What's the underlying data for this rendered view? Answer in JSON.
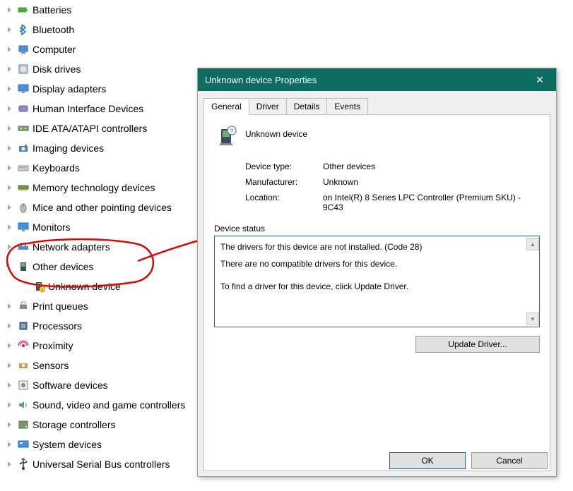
{
  "tree": {
    "items": [
      {
        "label": "Batteries",
        "icon": "battery"
      },
      {
        "label": "Bluetooth",
        "icon": "bluetooth"
      },
      {
        "label": "Computer",
        "icon": "computer"
      },
      {
        "label": "Disk drives",
        "icon": "disk"
      },
      {
        "label": "Display adapters",
        "icon": "monitor"
      },
      {
        "label": "Human Interface Devices",
        "icon": "hid"
      },
      {
        "label": "IDE ATA/ATAPI controllers",
        "icon": "ide"
      },
      {
        "label": "Imaging devices",
        "icon": "camera"
      },
      {
        "label": "Keyboards",
        "icon": "keyboard"
      },
      {
        "label": "Memory technology devices",
        "icon": "memory"
      },
      {
        "label": "Mice and other pointing devices",
        "icon": "mouse"
      },
      {
        "label": "Monitors",
        "icon": "monitor"
      },
      {
        "label": "Network adapters",
        "icon": "network"
      },
      {
        "label": "Other devices",
        "icon": "other",
        "expanded": true,
        "children": [
          {
            "label": "Unknown device",
            "icon": "unknown"
          }
        ]
      },
      {
        "label": "Print queues",
        "icon": "printer"
      },
      {
        "label": "Processors",
        "icon": "cpu"
      },
      {
        "label": "Proximity",
        "icon": "proximity"
      },
      {
        "label": "Sensors",
        "icon": "sensor"
      },
      {
        "label": "Software devices",
        "icon": "software"
      },
      {
        "label": "Sound, video and game controllers",
        "icon": "sound"
      },
      {
        "label": "Storage controllers",
        "icon": "storage"
      },
      {
        "label": "System devices",
        "icon": "system"
      },
      {
        "label": "Universal Serial Bus controllers",
        "icon": "usb"
      }
    ]
  },
  "dialog": {
    "title": "Unknown device Properties",
    "close": "✕",
    "tabs": [
      "General",
      "Driver",
      "Details",
      "Events"
    ],
    "active_tab": 0,
    "device_name": "Unknown device",
    "rows": {
      "type_label": "Device type:",
      "type_value": "Other devices",
      "mfr_label": "Manufacturer:",
      "mfr_value": "Unknown",
      "loc_label": "Location:",
      "loc_value": "on Intel(R) 8 Series LPC Controller (Premium SKU) - 9C43"
    },
    "status_title": "Device status",
    "status_lines": [
      "The drivers for this device are not installed. (Code 28)",
      "There are no compatible drivers for this device.",
      "To find a driver for this device, click Update Driver."
    ],
    "update_btn": "Update Driver...",
    "ok": "OK",
    "cancel": "Cancel"
  }
}
